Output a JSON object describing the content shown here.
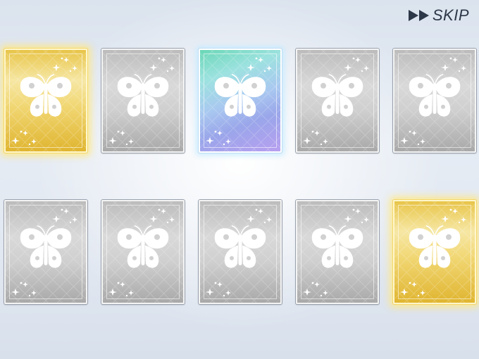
{
  "header": {
    "skip_label": "SKIP",
    "skip_icon": "fast-forward-icon"
  },
  "cards": [
    {
      "rarity": "gold"
    },
    {
      "rarity": "silver"
    },
    {
      "rarity": "rainbow"
    },
    {
      "rarity": "silver"
    },
    {
      "rarity": "silver"
    },
    {
      "rarity": "silver"
    },
    {
      "rarity": "silver"
    },
    {
      "rarity": "silver"
    },
    {
      "rarity": "silver"
    },
    {
      "rarity": "gold"
    }
  ],
  "card_emblem_icon": "butterfly-icon",
  "colors": {
    "gold": "#ecd06a",
    "silver": "#cfcfcf",
    "rainbow": "#9fc8ee",
    "background": "#e2e8f1",
    "skip_text": "#2c3748"
  }
}
